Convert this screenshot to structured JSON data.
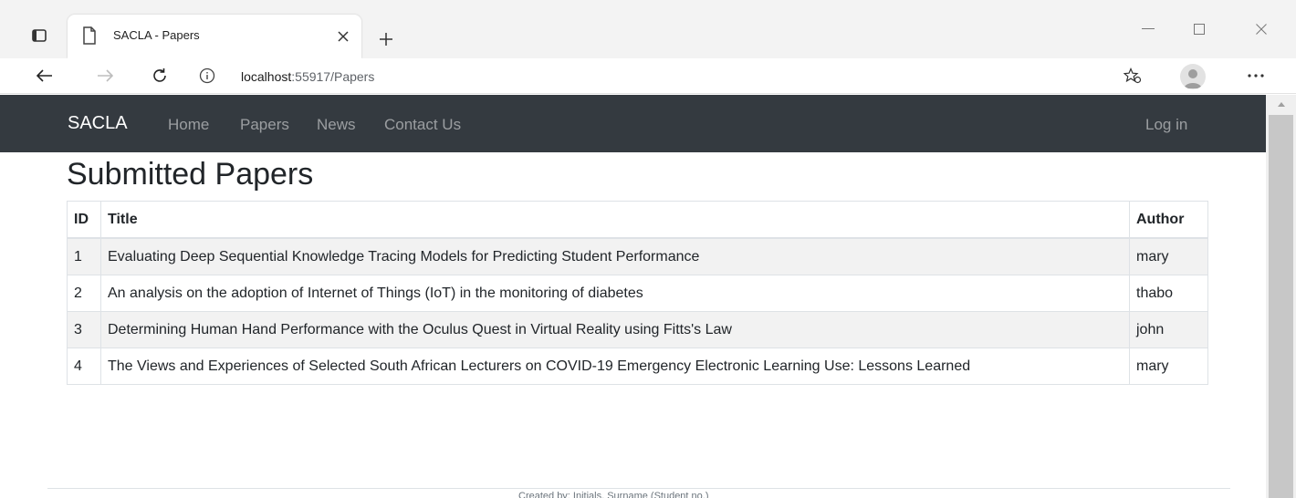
{
  "browser": {
    "tab_title": "SACLA - Papers",
    "url_host": "localhost",
    "url_rest": ":55917/Papers"
  },
  "navbar": {
    "brand": "SACLA",
    "links": [
      "Home",
      "Papers",
      "News",
      "Contact Us"
    ],
    "login": "Log in"
  },
  "page": {
    "title": "Submitted Papers"
  },
  "table": {
    "headers": {
      "id": "ID",
      "title": "Title",
      "author": "Author"
    },
    "rows": [
      {
        "id": "1",
        "title": "Evaluating Deep Sequential Knowledge Tracing Models for Predicting Student Performance",
        "author": "mary"
      },
      {
        "id": "2",
        "title": "An analysis on the adoption of Internet of Things (IoT) in the monitoring of diabetes",
        "author": "thabo"
      },
      {
        "id": "3",
        "title": "Determining Human Hand Performance with the Oculus Quest in Virtual Reality using Fitts's Law",
        "author": "john"
      },
      {
        "id": "4",
        "title": "The Views and Experiences of Selected South African Lecturers on COVID-19 Emergency Electronic Learning Use: Lessons Learned",
        "author": "mary"
      }
    ]
  },
  "footer": {
    "text": "Created by: Initials, Surname (Student no.)"
  },
  "icons": {
    "tab_actions": "tab-actions-icon",
    "page": "page-icon",
    "close": "close-icon",
    "add": "plus-icon",
    "back": "arrow-left-icon",
    "forward": "arrow-right-icon",
    "refresh": "refresh-icon",
    "info": "info-icon",
    "favorites": "star-icon",
    "profile": "avatar-icon",
    "more": "more-icon",
    "minimize": "minimize-icon",
    "maximize": "maximize-icon"
  },
  "colors": {
    "navbar_bg": "#343a40",
    "tab_strip_bg": "#f3f3f3",
    "table_border": "#dee2e6",
    "striped_row": "#f2f2f2"
  }
}
